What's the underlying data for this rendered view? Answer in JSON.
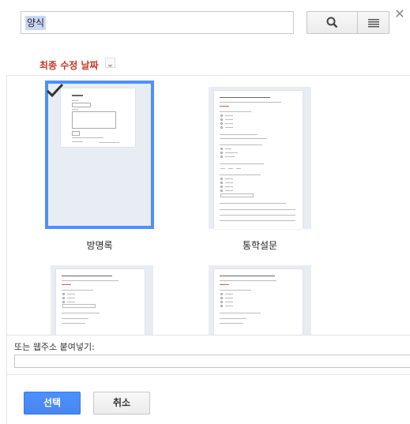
{
  "search": {
    "value": "양식"
  },
  "toolbar": {
    "close_glyph": "✕",
    "search_icon": "search-icon",
    "list_icon": "list-view-icon"
  },
  "sort": {
    "label": "최종 수정 날짜"
  },
  "templates": [
    {
      "title": "방명록",
      "selected": true,
      "doc_title": "방명록"
    },
    {
      "title": "통학설문",
      "selected": false,
      "doc_title": "통학 및 출퇴근 교통편 설문조사"
    },
    {
      "title": "",
      "selected": false,
      "doc_title": "전망에 대한 만족도 설문"
    },
    {
      "title": "",
      "selected": false,
      "doc_title": "인턴대학교에 대한 질문 설문"
    }
  ],
  "url": {
    "label": "또는 웹주소 붙여넣기:",
    "value": ""
  },
  "footer": {
    "select_label": "선택",
    "cancel_label": "취소"
  },
  "colors": {
    "accent": "#4d90fe",
    "sort_label": "#c53929"
  }
}
